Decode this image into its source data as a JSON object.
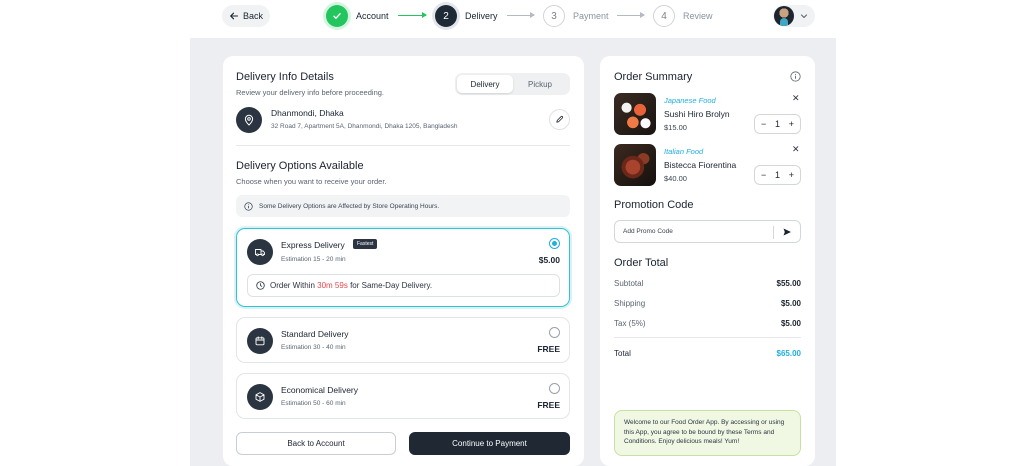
{
  "header": {
    "back_label": "Back",
    "steps": [
      {
        "number": "1",
        "label": "Account",
        "state": "done"
      },
      {
        "number": "2",
        "label": "Delivery",
        "state": "active"
      },
      {
        "number": "3",
        "label": "Payment",
        "state": "todo"
      },
      {
        "number": "4",
        "label": "Review",
        "state": "todo"
      }
    ]
  },
  "delivery_info": {
    "title": "Delivery Info Details",
    "subtitle": "Review your delivery info before proceeding.",
    "tabs": [
      {
        "label": "Delivery",
        "selected": true
      },
      {
        "label": "Pickup",
        "selected": false
      }
    ],
    "address_name": "Dhanmondi, Dhaka",
    "address_line": "32 Road 7, Apartment 5A, Dhanmondi, Dhaka 1205, Bangladesh"
  },
  "delivery_options": {
    "title": "Delivery Options Available",
    "subtitle": "Choose when you want to receive your order.",
    "notice": "Some Delivery Options are Affected by Store Operating Hours.",
    "options": [
      {
        "name": "Express Delivery",
        "badge": "Fastest",
        "estimation": "Estimation 15 - 20 min",
        "price": "$5.00",
        "selected": true,
        "icon": "truck-icon"
      },
      {
        "name": "Standard Delivery",
        "estimation": "Estimation 30 - 40 min",
        "price": "FREE",
        "selected": false,
        "icon": "calendar-icon"
      },
      {
        "name": "Economical Delivery",
        "estimation": "Estimation 50 - 60 min",
        "price": "FREE",
        "selected": false,
        "icon": "box-icon"
      }
    ],
    "timer_prefix": "Order Within",
    "timer_value": "30m 59s",
    "timer_suffix": "for Same-Day Delivery."
  },
  "actions": {
    "back_to_account": "Back to Account",
    "continue_to_payment": "Continue to Payment"
  },
  "order_summary": {
    "title": "Order Summary",
    "items": [
      {
        "category": "Japanese Food",
        "name": "Sushi Hiro Brolyn",
        "price": "$15.00",
        "qty": "1"
      },
      {
        "category": "Italian Food",
        "name": "Bistecca Fiorentina",
        "price": "$40.00",
        "qty": "1"
      }
    ],
    "promo_title": "Promotion Code",
    "promo_placeholder": "Add Promo Code",
    "total_title": "Order Total",
    "rows": [
      {
        "label": "Subtotal",
        "value": "$55.00"
      },
      {
        "label": "Shipping",
        "value": "$5.00"
      },
      {
        "label": "Tax (5%)",
        "value": "$5.00"
      }
    ],
    "total_label": "Total",
    "total_value": "$65.00",
    "terms": "Welcome to our Food Order App. By accessing or using this App, you agree to be bound by these Terms and Conditions. Enjoy delicious meals! Yum!"
  },
  "colors": {
    "accent": "#22aee0",
    "success": "#22c55e",
    "dark": "#1f2833",
    "danger": "#e5484d"
  }
}
